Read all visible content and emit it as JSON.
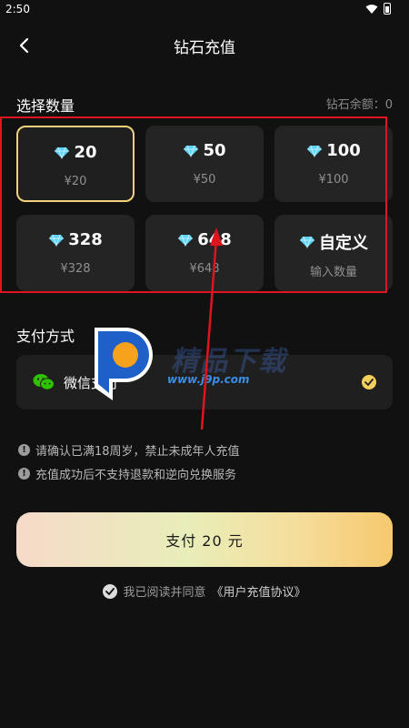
{
  "status_bar": {
    "time": "2:50"
  },
  "header": {
    "title": "钻石充值"
  },
  "section_quantity": {
    "title": "选择数量",
    "balance": "钻石余额：0"
  },
  "packages": [
    {
      "amount": "20",
      "price": "¥20",
      "selected": true
    },
    {
      "amount": "50",
      "price": "¥50",
      "selected": false
    },
    {
      "amount": "100",
      "price": "¥100",
      "selected": false
    },
    {
      "amount": "328",
      "price": "¥328",
      "selected": false
    },
    {
      "amount": "648",
      "price": "¥648",
      "selected": false
    },
    {
      "amount": "自定义",
      "price": "输入数量",
      "selected": false
    }
  ],
  "section_payment": {
    "title": "支付方式"
  },
  "payment": {
    "label": "微信支付",
    "selected": true
  },
  "notices": [
    "请确认已满18周岁，禁止未成年人充值",
    "充值成功后不支持退款和逆向兑换服务"
  ],
  "pay_button": {
    "label": "支付 20 元"
  },
  "agreement": {
    "prefix": "我已阅读并同意",
    "link": "《用户充值协议》"
  },
  "watermark": {
    "text": "精品下载",
    "url": "www.j9p.com"
  },
  "colors": {
    "background": "#111111",
    "card": "#242424",
    "selected_border": "#f3d27b",
    "annotation_red": "#e0141e",
    "check_yellow": "#f4cf5b"
  }
}
